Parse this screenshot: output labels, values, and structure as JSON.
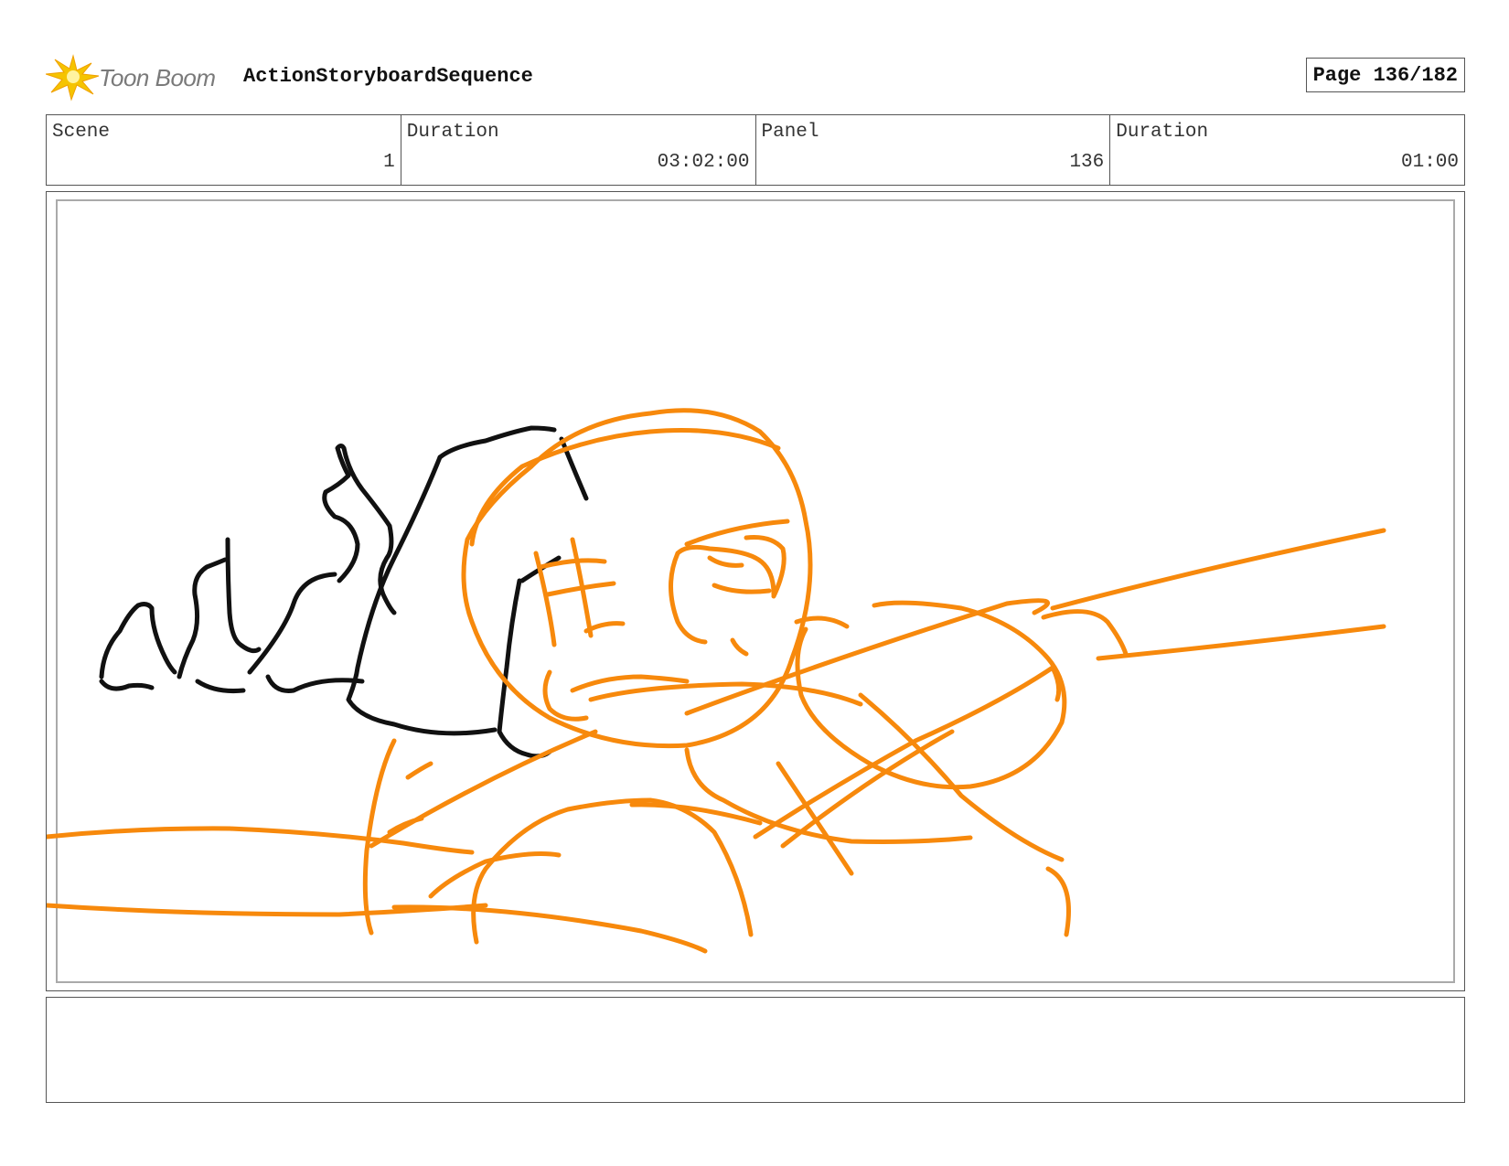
{
  "header": {
    "logo_text": "Toon Boom",
    "sequence_title": "ActionStoryboardSequence",
    "page_label": "Page 136/182"
  },
  "info": {
    "scene_label": "Scene",
    "scene_value": "1",
    "scene_duration_label": "Duration",
    "scene_duration_value": "03:02:00",
    "panel_label": "Panel",
    "panel_value": "136",
    "panel_duration_label": "Duration",
    "panel_duration_value": "01:00"
  },
  "colors": {
    "sketch_orange": "#f7890c",
    "sketch_black": "#111111",
    "logo_yellow": "#f5c400"
  },
  "notes": ""
}
